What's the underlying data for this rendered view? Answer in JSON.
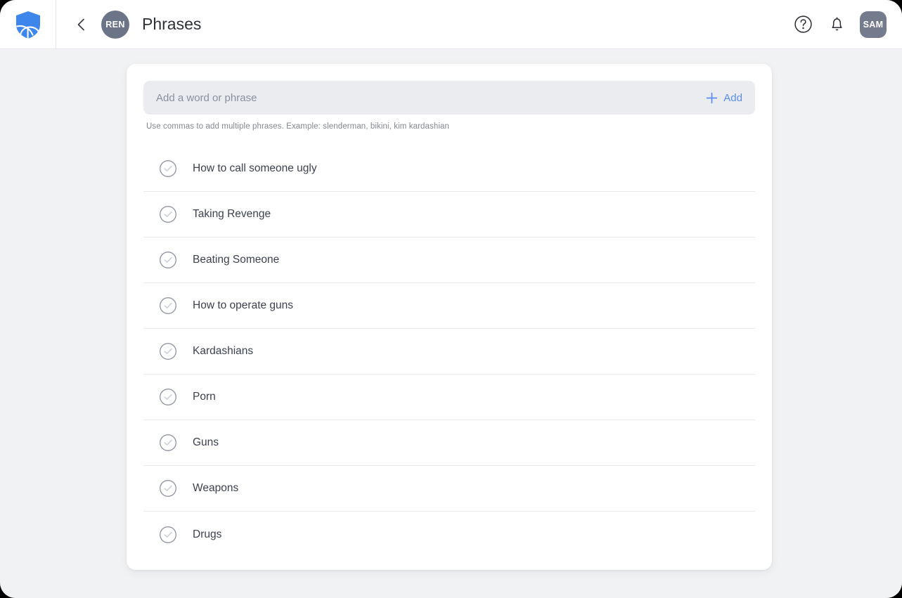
{
  "window": {
    "background_color": "#f1f2f4",
    "frame_color": "#8f9094"
  },
  "header": {
    "logo_icon": "shield-logo-icon",
    "logo_color": "#3d86ec",
    "back_icon": "chevron-left-icon",
    "account_avatar_initials": "REN",
    "account_avatar_color": "#6c7587",
    "title": "Phrases",
    "help_icon": "help-circle-icon",
    "notifications_icon": "bell-icon",
    "user_avatar_initials": "SAM",
    "user_avatar_color": "#737b8c"
  },
  "add_phrase": {
    "placeholder": "Add a word or phrase",
    "value": "",
    "add_icon": "plus-icon",
    "add_label": "Add",
    "add_color": "#5a8df0",
    "helper_text": "Use commas to add multiple phrases. Example: slenderman, bikini, kim kardashian"
  },
  "phrase_list": {
    "item_icon": "check-circle-icon",
    "items": [
      {
        "label": "How to call someone ugly"
      },
      {
        "label": "Taking Revenge"
      },
      {
        "label": "Beating Someone"
      },
      {
        "label": "How to operate guns"
      },
      {
        "label": "Kardashians"
      },
      {
        "label": "Porn"
      },
      {
        "label": "Guns"
      },
      {
        "label": "Weapons"
      },
      {
        "label": "Drugs"
      }
    ]
  }
}
